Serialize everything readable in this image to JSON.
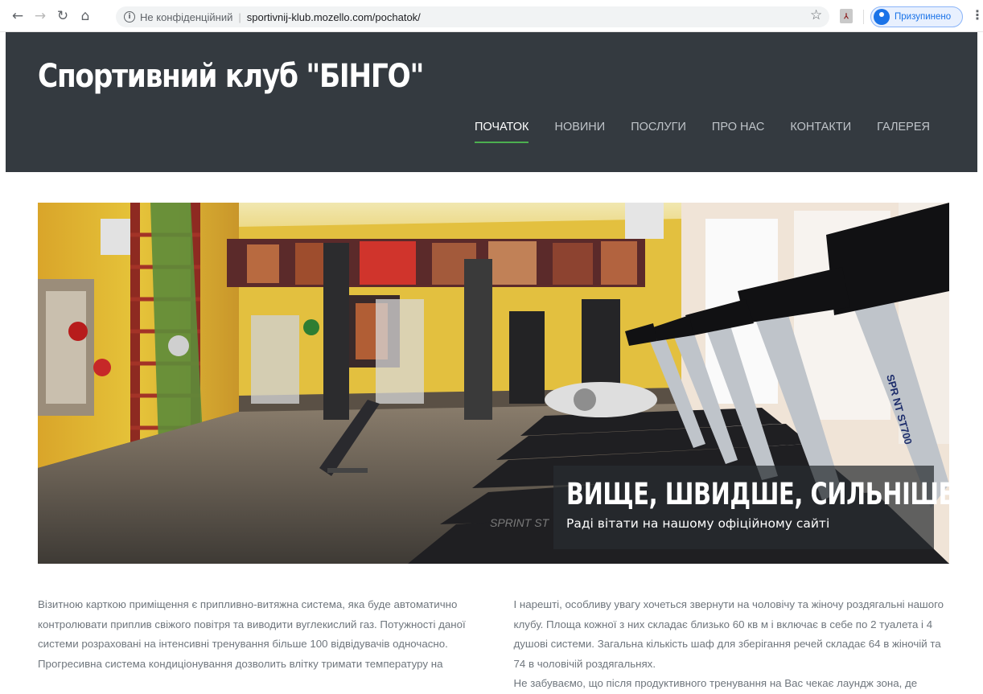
{
  "browser": {
    "security_label": "Не конфіденційний",
    "url": "sportivnij-klub.mozello.com/pochatok/",
    "profile_label": "Призупинено"
  },
  "site": {
    "title": "Спортивний клуб \"БІНГО\"",
    "nav": [
      {
        "label": "ПОЧАТОК",
        "active": true
      },
      {
        "label": "НОВИНИ"
      },
      {
        "label": "ПОСЛУГИ"
      },
      {
        "label": "ПРО НАС"
      },
      {
        "label": "КОНТАКТИ"
      },
      {
        "label": "ГАЛЕРЕЯ"
      }
    ]
  },
  "hero": {
    "heading": "ВИЩЕ, ШВИДШЕ, СИЛЬНІШЕ...",
    "subheading": "Раді вітати на нашому офіційному сайті",
    "treadmill_labels": [
      "SPR NT ST700",
      "SPRINT ST"
    ]
  },
  "content": {
    "left": [
      "Візитною карткою приміщення є припливно-витяжна система, яка буде автоматично контролювати приплив свіжого повітря та виводити вуглекислий газ. Потужності даної системи розраховані на інтенсивні тренування більше 100 відвідувачів одночасно.",
      "Прогресивна система кондиціонування дозволить влітку тримати температуру на"
    ],
    "right": [
      "І нарешті, особливу увагу хочеться звернути на чоловічу та жіночу роздягальні нашого клубу. Площа кожної з них складає близько 60 кв м і включає в себе по 2 туалета і 4 душові системи. Загальна кількість шаф для зберігання речей складає 64 в жіночій та 74 в чоловічій роздягальнях.",
      "Не забуваємо, що після продуктивного тренування на Вас чекає лаундж зона, де"
    ]
  }
}
